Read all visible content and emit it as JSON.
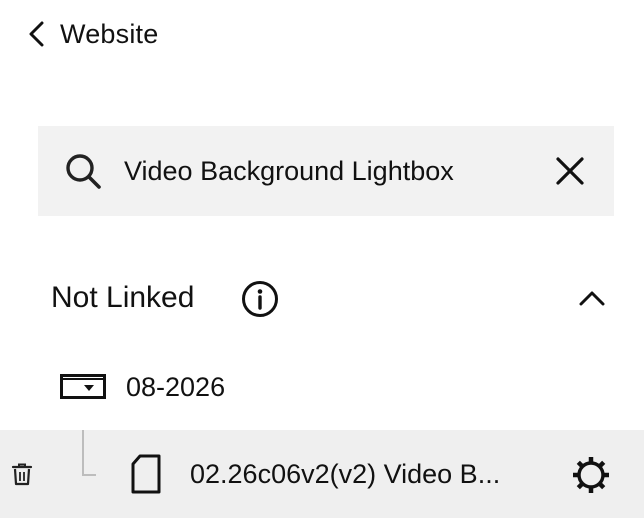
{
  "header": {
    "back_label": "Website",
    "back_icon": "chevron-left-icon"
  },
  "search": {
    "value": "Video Background Lightbox",
    "placeholder": "Search",
    "icon": "search-icon",
    "clear_icon": "close-icon"
  },
  "section": {
    "title": "Not Linked",
    "info_icon": "info-icon",
    "collapse_icon": "chevron-up-icon",
    "expanded": true
  },
  "folder": {
    "label": "08-2026",
    "icon": "folder-dropdown-icon"
  },
  "page_item": {
    "label": "02.26c06v2(v2) Video B...",
    "icon": "page-icon",
    "delete_icon": "trash-icon",
    "settings_icon": "gear-icon"
  },
  "colors": {
    "text": "#111111",
    "search_background": "#f2f2f2",
    "selected_row_background": "#efefef",
    "connector": "#bdbdbd"
  }
}
